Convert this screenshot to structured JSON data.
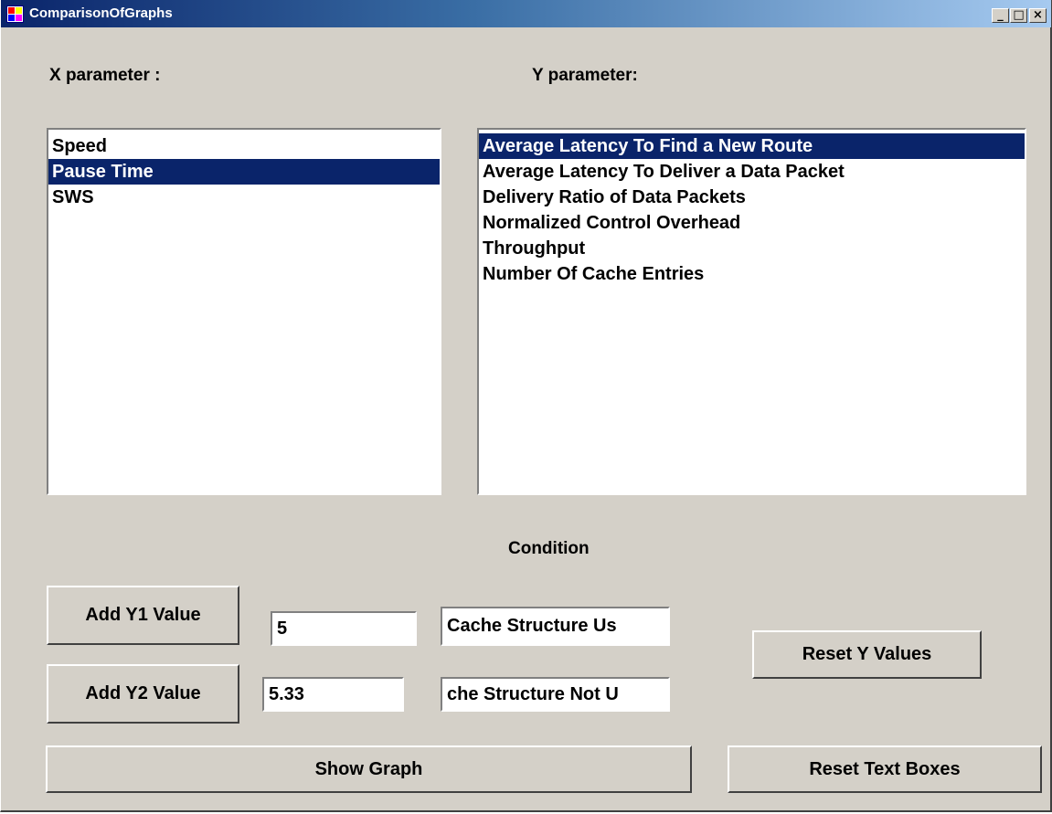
{
  "window": {
    "title": "ComparisonOfGraphs",
    "minimize_glyph": "_",
    "maximize_glyph": "□",
    "close_glyph": "×"
  },
  "labels": {
    "x_parameter": "X parameter :",
    "y_parameter": "Y parameter:",
    "condition": "Condition"
  },
  "x_list": {
    "items": [
      "Speed",
      "Pause Time",
      "SWS"
    ],
    "selected": "Pause Time"
  },
  "y_list": {
    "items": [
      "Average Latency To Find a New Route",
      "Average Latency To Deliver a Data Packet",
      "Delivery Ratio of Data Packets",
      "Normalized Control Overhead",
      "Throughput",
      "Number Of Cache Entries"
    ],
    "selected": "Average Latency To Find a New Route"
  },
  "y1": {
    "button_label": "Add Y1 Value",
    "value": "5",
    "condition_text": "Cache Structure Us"
  },
  "y2": {
    "button_label": "Add Y2 Value",
    "value": "5.33",
    "condition_text": "che Structure Not U"
  },
  "buttons": {
    "reset_y_values": "Reset Y Values",
    "show_graph": "Show Graph",
    "reset_text_boxes": "Reset Text Boxes"
  },
  "colors": {
    "face": "#d4d0c8",
    "selection": "#0a246a",
    "titlebar_start": "#0a246a",
    "titlebar_end": "#a6caf0"
  }
}
